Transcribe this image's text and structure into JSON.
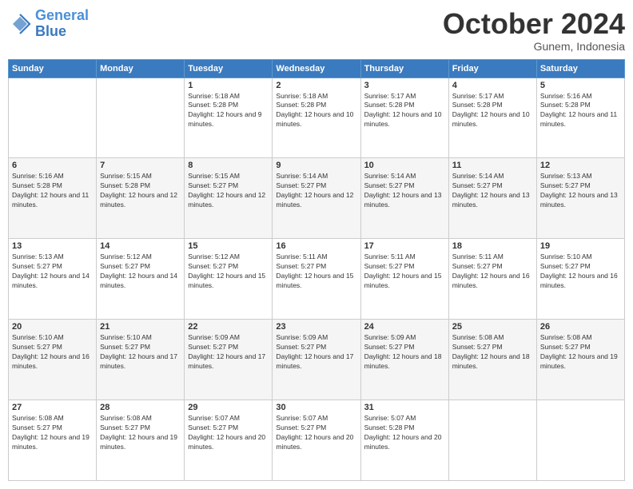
{
  "logo": {
    "line1": "General",
    "line2": "Blue"
  },
  "header": {
    "month": "October 2024",
    "location": "Gunem, Indonesia"
  },
  "weekdays": [
    "Sunday",
    "Monday",
    "Tuesday",
    "Wednesday",
    "Thursday",
    "Friday",
    "Saturday"
  ],
  "weeks": [
    [
      {
        "day": "",
        "sunrise": "",
        "sunset": "",
        "daylight": ""
      },
      {
        "day": "",
        "sunrise": "",
        "sunset": "",
        "daylight": ""
      },
      {
        "day": "1",
        "sunrise": "Sunrise: 5:18 AM",
        "sunset": "Sunset: 5:28 PM",
        "daylight": "Daylight: 12 hours and 9 minutes."
      },
      {
        "day": "2",
        "sunrise": "Sunrise: 5:18 AM",
        "sunset": "Sunset: 5:28 PM",
        "daylight": "Daylight: 12 hours and 10 minutes."
      },
      {
        "day": "3",
        "sunrise": "Sunrise: 5:17 AM",
        "sunset": "Sunset: 5:28 PM",
        "daylight": "Daylight: 12 hours and 10 minutes."
      },
      {
        "day": "4",
        "sunrise": "Sunrise: 5:17 AM",
        "sunset": "Sunset: 5:28 PM",
        "daylight": "Daylight: 12 hours and 10 minutes."
      },
      {
        "day": "5",
        "sunrise": "Sunrise: 5:16 AM",
        "sunset": "Sunset: 5:28 PM",
        "daylight": "Daylight: 12 hours and 11 minutes."
      }
    ],
    [
      {
        "day": "6",
        "sunrise": "Sunrise: 5:16 AM",
        "sunset": "Sunset: 5:28 PM",
        "daylight": "Daylight: 12 hours and 11 minutes."
      },
      {
        "day": "7",
        "sunrise": "Sunrise: 5:15 AM",
        "sunset": "Sunset: 5:28 PM",
        "daylight": "Daylight: 12 hours and 12 minutes."
      },
      {
        "day": "8",
        "sunrise": "Sunrise: 5:15 AM",
        "sunset": "Sunset: 5:27 PM",
        "daylight": "Daylight: 12 hours and 12 minutes."
      },
      {
        "day": "9",
        "sunrise": "Sunrise: 5:14 AM",
        "sunset": "Sunset: 5:27 PM",
        "daylight": "Daylight: 12 hours and 12 minutes."
      },
      {
        "day": "10",
        "sunrise": "Sunrise: 5:14 AM",
        "sunset": "Sunset: 5:27 PM",
        "daylight": "Daylight: 12 hours and 13 minutes."
      },
      {
        "day": "11",
        "sunrise": "Sunrise: 5:14 AM",
        "sunset": "Sunset: 5:27 PM",
        "daylight": "Daylight: 12 hours and 13 minutes."
      },
      {
        "day": "12",
        "sunrise": "Sunrise: 5:13 AM",
        "sunset": "Sunset: 5:27 PM",
        "daylight": "Daylight: 12 hours and 13 minutes."
      }
    ],
    [
      {
        "day": "13",
        "sunrise": "Sunrise: 5:13 AM",
        "sunset": "Sunset: 5:27 PM",
        "daylight": "Daylight: 12 hours and 14 minutes."
      },
      {
        "day": "14",
        "sunrise": "Sunrise: 5:12 AM",
        "sunset": "Sunset: 5:27 PM",
        "daylight": "Daylight: 12 hours and 14 minutes."
      },
      {
        "day": "15",
        "sunrise": "Sunrise: 5:12 AM",
        "sunset": "Sunset: 5:27 PM",
        "daylight": "Daylight: 12 hours and 15 minutes."
      },
      {
        "day": "16",
        "sunrise": "Sunrise: 5:11 AM",
        "sunset": "Sunset: 5:27 PM",
        "daylight": "Daylight: 12 hours and 15 minutes."
      },
      {
        "day": "17",
        "sunrise": "Sunrise: 5:11 AM",
        "sunset": "Sunset: 5:27 PM",
        "daylight": "Daylight: 12 hours and 15 minutes."
      },
      {
        "day": "18",
        "sunrise": "Sunrise: 5:11 AM",
        "sunset": "Sunset: 5:27 PM",
        "daylight": "Daylight: 12 hours and 16 minutes."
      },
      {
        "day": "19",
        "sunrise": "Sunrise: 5:10 AM",
        "sunset": "Sunset: 5:27 PM",
        "daylight": "Daylight: 12 hours and 16 minutes."
      }
    ],
    [
      {
        "day": "20",
        "sunrise": "Sunrise: 5:10 AM",
        "sunset": "Sunset: 5:27 PM",
        "daylight": "Daylight: 12 hours and 16 minutes."
      },
      {
        "day": "21",
        "sunrise": "Sunrise: 5:10 AM",
        "sunset": "Sunset: 5:27 PM",
        "daylight": "Daylight: 12 hours and 17 minutes."
      },
      {
        "day": "22",
        "sunrise": "Sunrise: 5:09 AM",
        "sunset": "Sunset: 5:27 PM",
        "daylight": "Daylight: 12 hours and 17 minutes."
      },
      {
        "day": "23",
        "sunrise": "Sunrise: 5:09 AM",
        "sunset": "Sunset: 5:27 PM",
        "daylight": "Daylight: 12 hours and 17 minutes."
      },
      {
        "day": "24",
        "sunrise": "Sunrise: 5:09 AM",
        "sunset": "Sunset: 5:27 PM",
        "daylight": "Daylight: 12 hours and 18 minutes."
      },
      {
        "day": "25",
        "sunrise": "Sunrise: 5:08 AM",
        "sunset": "Sunset: 5:27 PM",
        "daylight": "Daylight: 12 hours and 18 minutes."
      },
      {
        "day": "26",
        "sunrise": "Sunrise: 5:08 AM",
        "sunset": "Sunset: 5:27 PM",
        "daylight": "Daylight: 12 hours and 19 minutes."
      }
    ],
    [
      {
        "day": "27",
        "sunrise": "Sunrise: 5:08 AM",
        "sunset": "Sunset: 5:27 PM",
        "daylight": "Daylight: 12 hours and 19 minutes."
      },
      {
        "day": "28",
        "sunrise": "Sunrise: 5:08 AM",
        "sunset": "Sunset: 5:27 PM",
        "daylight": "Daylight: 12 hours and 19 minutes."
      },
      {
        "day": "29",
        "sunrise": "Sunrise: 5:07 AM",
        "sunset": "Sunset: 5:27 PM",
        "daylight": "Daylight: 12 hours and 20 minutes."
      },
      {
        "day": "30",
        "sunrise": "Sunrise: 5:07 AM",
        "sunset": "Sunset: 5:27 PM",
        "daylight": "Daylight: 12 hours and 20 minutes."
      },
      {
        "day": "31",
        "sunrise": "Sunrise: 5:07 AM",
        "sunset": "Sunset: 5:28 PM",
        "daylight": "Daylight: 12 hours and 20 minutes."
      },
      {
        "day": "",
        "sunrise": "",
        "sunset": "",
        "daylight": ""
      },
      {
        "day": "",
        "sunrise": "",
        "sunset": "",
        "daylight": ""
      }
    ]
  ]
}
